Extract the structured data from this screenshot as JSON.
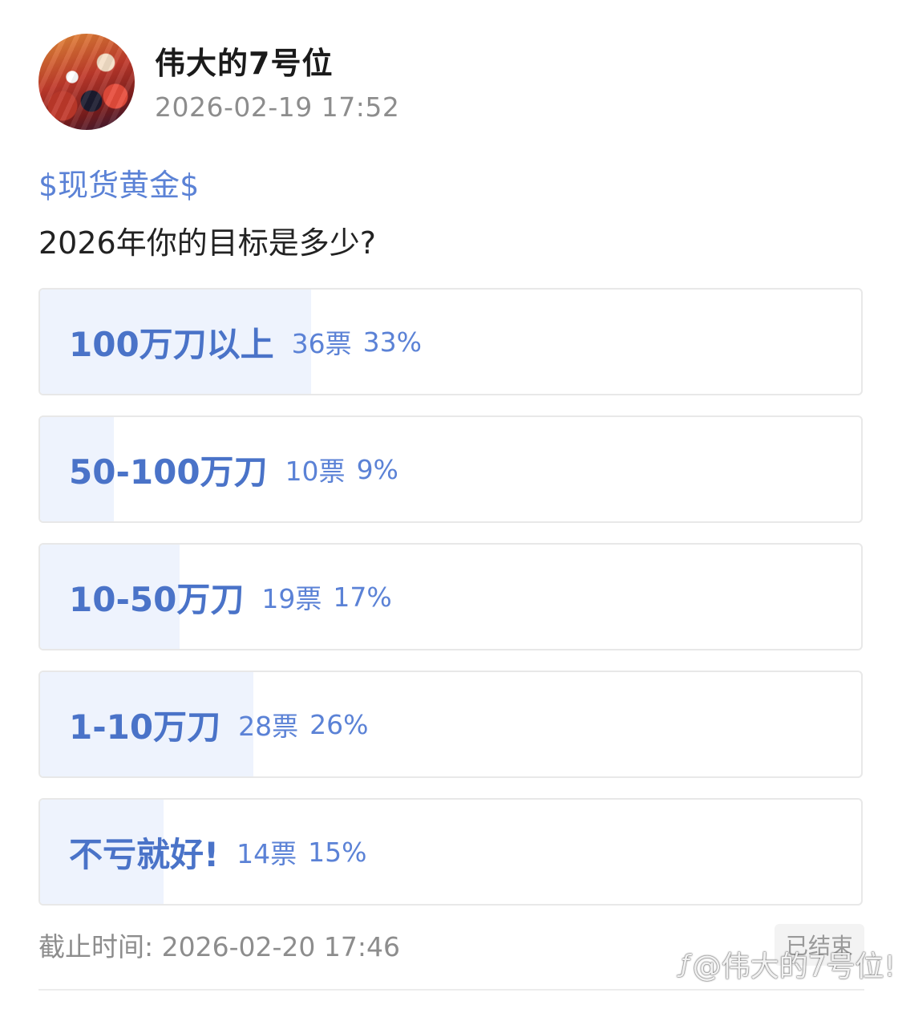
{
  "post": {
    "username": "伟大的7号位",
    "timestamp": "2026-02-19 17:52",
    "topic": "$现货黄金$",
    "question": "2026年你的目标是多少?"
  },
  "poll": {
    "options": [
      {
        "label": "100万刀以上",
        "votes": "36票",
        "percent": "33%",
        "share": 0.33
      },
      {
        "label": "50-100万刀",
        "votes": "10票",
        "percent": "9%",
        "share": 0.09
      },
      {
        "label": "10-50万刀",
        "votes": "19票",
        "percent": "17%",
        "share": 0.17
      },
      {
        "label": "1-10万刀",
        "votes": "28票",
        "percent": "26%",
        "share": 0.26
      },
      {
        "label": "不亏就好!",
        "votes": "14票",
        "percent": "15%",
        "share": 0.15
      }
    ],
    "deadline": "截止时间: 2026-02-20 17:46",
    "status": "已结束"
  },
  "watermark": {
    "icon": "zhihu-logo-icon",
    "text": "@伟大的7号位!"
  },
  "colors": {
    "accent": "#5b82d6",
    "option_fill": "#eef3fd",
    "muted_text": "#8d8d8d"
  }
}
